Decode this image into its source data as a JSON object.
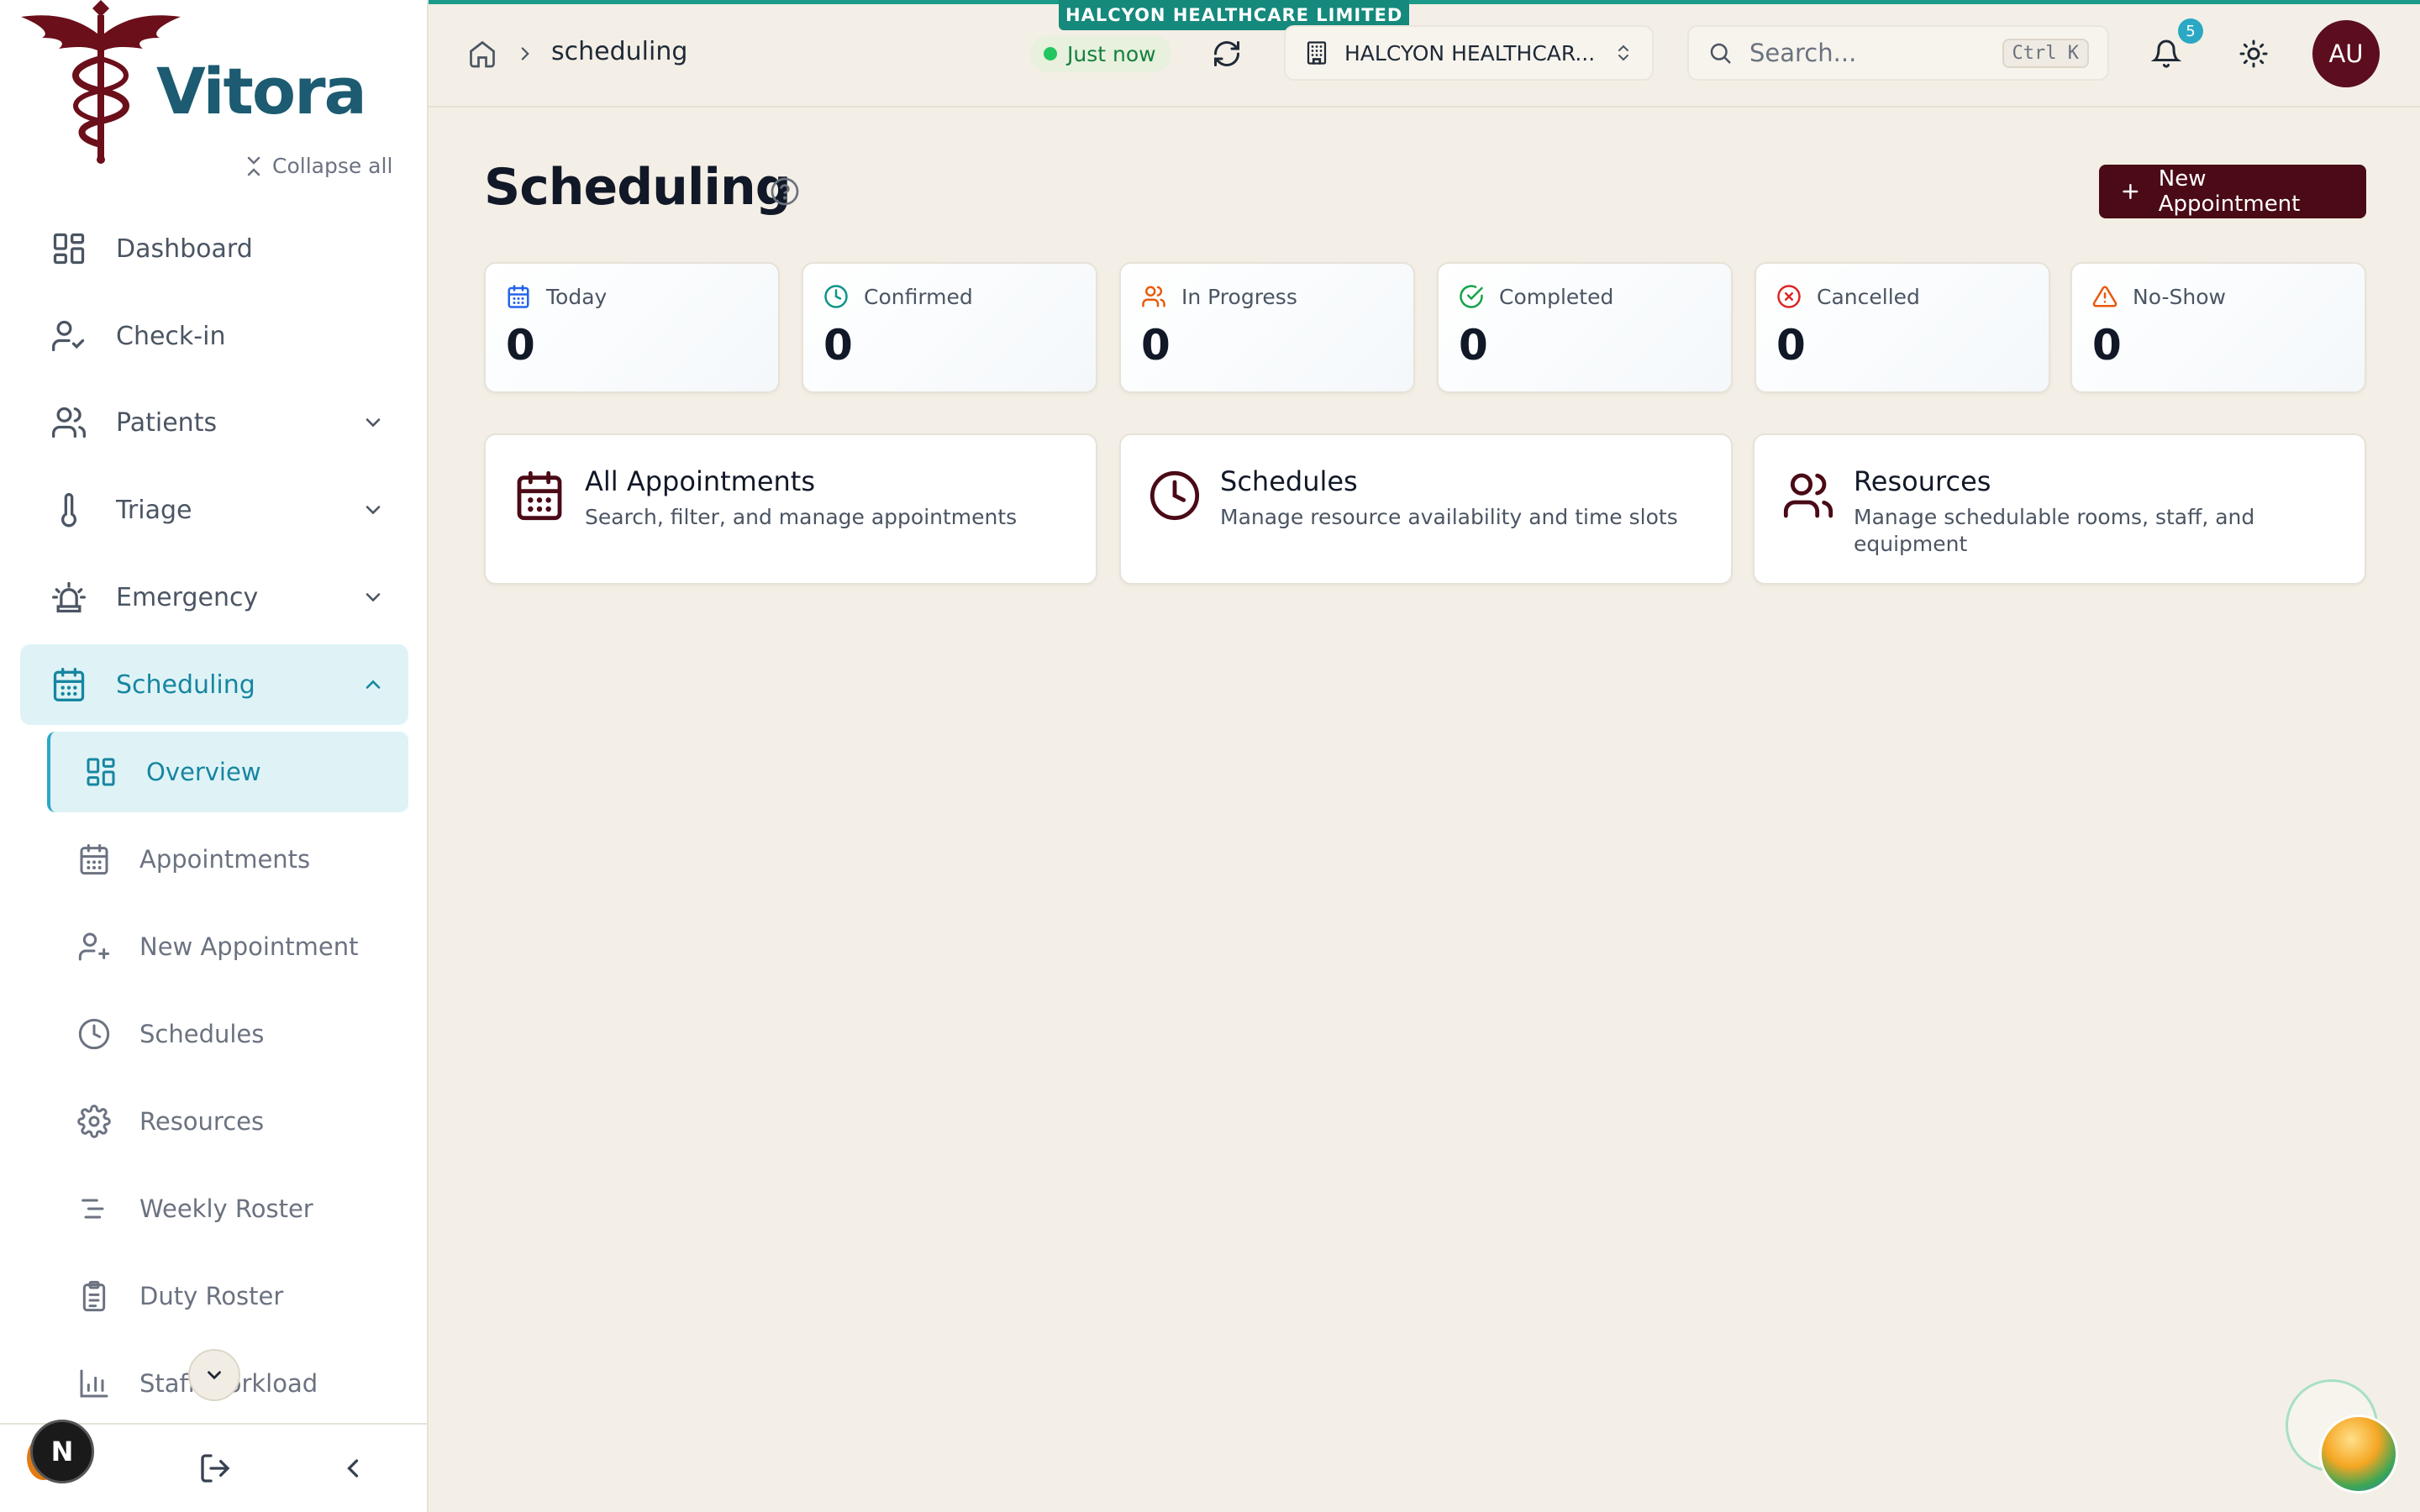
{
  "brand": {
    "name": "Vitora",
    "accent": "#1c5b72",
    "logo_color": "#6b0f1a"
  },
  "sidebar": {
    "collapse_all": "Collapse all",
    "items": [
      {
        "label": "Dashboard",
        "icon": "grid-icon",
        "expandable": false
      },
      {
        "label": "Check-in",
        "icon": "user-check-icon",
        "expandable": false
      },
      {
        "label": "Patients",
        "icon": "users-icon",
        "expandable": true
      },
      {
        "label": "Triage",
        "icon": "thermometer-icon",
        "expandable": true
      },
      {
        "label": "Emergency",
        "icon": "siren-icon",
        "expandable": true
      },
      {
        "label": "Scheduling",
        "icon": "calendar-icon",
        "expandable": true,
        "active": true
      }
    ],
    "sub_items": [
      {
        "label": "Overview",
        "icon": "grid-icon",
        "active": true
      },
      {
        "label": "Appointments",
        "icon": "calendar-icon"
      },
      {
        "label": "New Appointment",
        "icon": "user-plus-icon"
      },
      {
        "label": "Schedules",
        "icon": "clock-icon"
      },
      {
        "label": "Resources",
        "icon": "gear-icon"
      },
      {
        "label": "Weekly Roster",
        "icon": "lines-icon"
      },
      {
        "label": "Duty Roster",
        "icon": "clipboard-icon"
      },
      {
        "label": "Staff Workload",
        "icon": "bar-chart-icon"
      }
    ],
    "user_initial": "N"
  },
  "topbar": {
    "org_tag": "HALCYON HEALTHCARE LIMITED",
    "breadcrumb": "scheduling",
    "sync_status": "Just now",
    "org_select": "HALCYON HEALTHCAR...",
    "search_placeholder": "Search...",
    "shortcut_ctrl": "Ctrl",
    "shortcut_key": "K",
    "notification_count": "5",
    "avatar_initials": "AU"
  },
  "page": {
    "title": "Scheduling",
    "new_button": "New Appointment"
  },
  "stats": [
    {
      "label": "Today",
      "value": "0",
      "icon": "calendar-icon",
      "color": "#2563eb"
    },
    {
      "label": "Confirmed",
      "value": "0",
      "icon": "clock-icon",
      "color": "#0d9488"
    },
    {
      "label": "In Progress",
      "value": "0",
      "icon": "users-icon",
      "color": "#ea580c"
    },
    {
      "label": "Completed",
      "value": "0",
      "icon": "check-circle-icon",
      "color": "#16a34a"
    },
    {
      "label": "Cancelled",
      "value": "0",
      "icon": "x-circle-icon",
      "color": "#dc2626"
    },
    {
      "label": "No-Show",
      "value": "0",
      "icon": "alert-triangle-icon",
      "color": "#ea580c"
    }
  ],
  "links": [
    {
      "title": "All Appointments",
      "desc": "Search, filter, and manage appointments",
      "icon": "calendar-icon"
    },
    {
      "title": "Schedules",
      "desc": "Manage resource availability and time slots",
      "icon": "clock-icon"
    },
    {
      "title": "Resources",
      "desc": "Manage schedulable rooms, staff, and equipment",
      "icon": "users-icon"
    }
  ]
}
